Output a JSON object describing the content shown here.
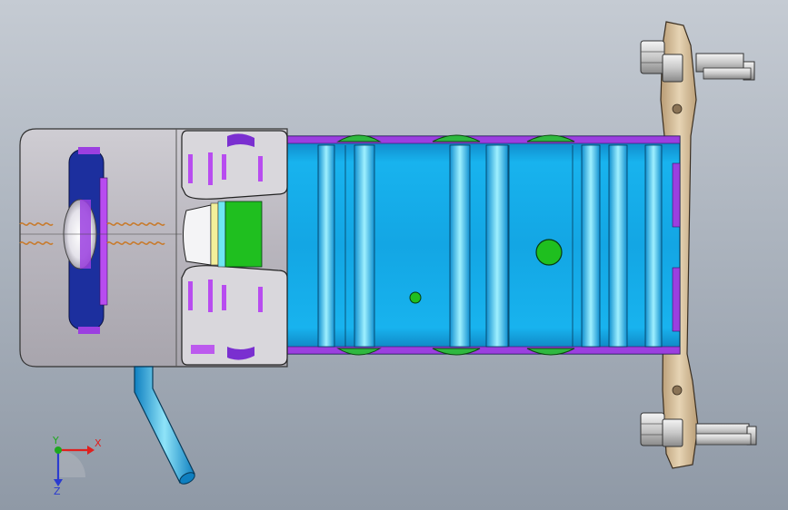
{
  "viewport": {
    "background_top": "#c5cbd3",
    "background_bottom": "#8f99a6"
  },
  "model": {
    "housing_color": "#b7b4bc",
    "frame_color": "#d9d7dc",
    "blue_plate_color": "#1c2f9e",
    "purple_accent": "#9b3fe0",
    "tube_color": "#12a7e6",
    "tube_highlight": "#8fe4f8",
    "green_ring_color": "#2fb840",
    "green_insert_color": "#1fbf1f",
    "bracket_color": "#cdb48e",
    "bolt_color": "#d8d8d8",
    "spring_color": "#c87a2b"
  },
  "triad": {
    "x_label": "X",
    "y_label": "Y",
    "z_label": "Z",
    "x_color": "#e0201e",
    "y_color": "#1ea81e",
    "z_color": "#2a3bd0"
  }
}
